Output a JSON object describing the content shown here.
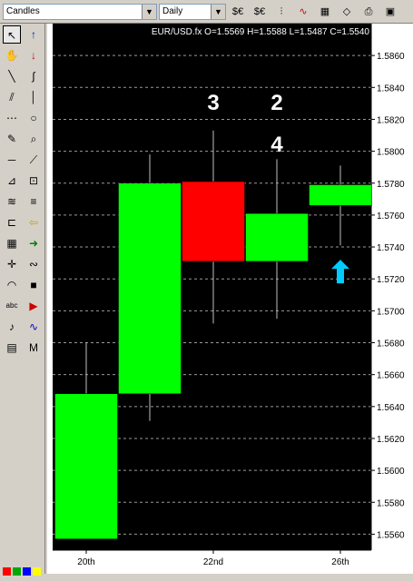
{
  "toolbar": {
    "chart_type": "Candles",
    "timeframe": "Daily",
    "icons": [
      "currency-icon",
      "currency-down-icon",
      "bars-icon",
      "chart-link-icon",
      "calendar-icon",
      "eraser-icon",
      "print-icon",
      "print-preview-icon"
    ]
  },
  "left_tools": [
    "pointer-icon",
    "arrow-up-red-icon",
    "hand-icon",
    "arrow-down-red-icon",
    "line-icon",
    "freehand-icon",
    "parallel-icon",
    "vertical-line-icon",
    "dotted-grid-icon",
    "circle-icon",
    "pencil-icon",
    "zoom-icon",
    "horizontal-line-icon",
    "rays-icon",
    "gann-icon",
    "zoom-box-icon",
    "fan-icon",
    "levels-icon",
    "channel-icon",
    "arrow-left-icon",
    "grid-icon",
    "arrow-right-icon",
    "crosshair-icon",
    "curve-text-icon",
    "arc-icon",
    "stop-icon",
    "text-icon",
    "buy-icon",
    "alert-icon",
    "wave-icon",
    "calculator-icon",
    "elliott-icon"
  ],
  "chart_data": {
    "type": "candlestick",
    "symbol_label": "EUR/USD.fx",
    "ohlc_readout": "O=1.5569 H=1.5588 L=1.5487 C=1.5540",
    "ylim": [
      1.555,
      1.588
    ],
    "y_ticks": [
      "1.5860",
      "1.5840",
      "1.5820",
      "1.5800",
      "1.5780",
      "1.5760",
      "1.5740",
      "1.5720",
      "1.5700",
      "1.5680",
      "1.5660",
      "1.5640",
      "1.5620",
      "1.5600",
      "1.5580",
      "1.5560"
    ],
    "x_labels": [
      {
        "label": "20th",
        "candle": 0
      },
      {
        "label": "22nd",
        "candle": 2
      },
      {
        "label": "26th",
        "candle": 4
      }
    ],
    "candles": [
      {
        "open": 1.5557,
        "high": 1.568,
        "low": 1.5557,
        "close": 1.5648,
        "color": "#00ff00"
      },
      {
        "open": 1.5648,
        "high": 1.5798,
        "low": 1.5631,
        "close": 1.578,
        "color": "#00ff00"
      },
      {
        "open": 1.5781,
        "high": 1.5813,
        "low": 1.5692,
        "close": 1.5731,
        "color": "#ff0000"
      },
      {
        "open": 1.5731,
        "high": 1.5795,
        "low": 1.5695,
        "close": 1.5761,
        "color": "#00ff00"
      },
      {
        "open": 1.5766,
        "high": 1.5791,
        "low": 1.5741,
        "close": 1.5779,
        "color": "#00ff00"
      }
    ],
    "annotations": [
      {
        "text": "3",
        "candle": 2,
        "price": 1.5831
      },
      {
        "text": "2",
        "candle": 3,
        "price": 1.5831
      },
      {
        "text": "4",
        "candle": 3,
        "price": 1.5805
      }
    ],
    "marker": {
      "type": "arrow-up",
      "candle": 4,
      "price": 1.5724,
      "color": "#00ccff"
    },
    "colors": {
      "background": "#000000",
      "grid": "#9a9a9a",
      "bull": "#00ff00",
      "bear": "#ff0000",
      "wick": "#c0c0c0",
      "text": "#ffffff"
    }
  },
  "status_colors": [
    "#ff0000",
    "#00aa00",
    "#0000ff",
    "#ffff00"
  ]
}
